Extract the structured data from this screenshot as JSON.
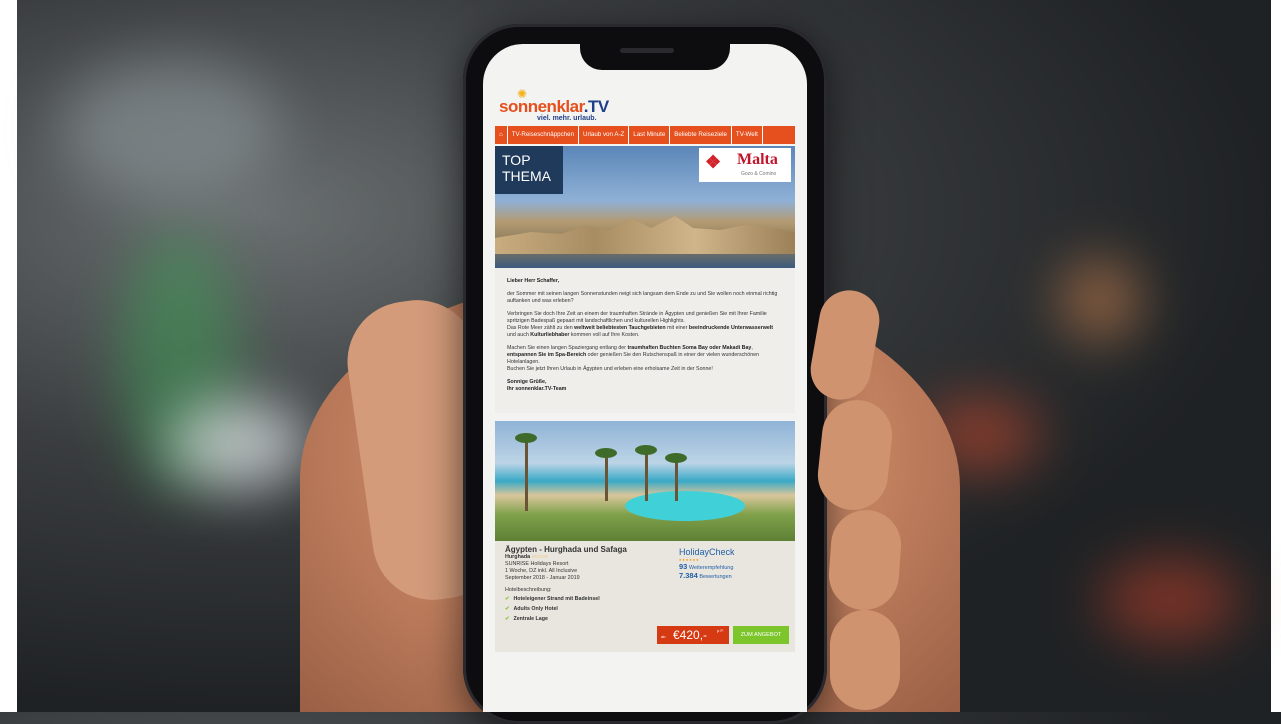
{
  "brand": {
    "name_part1": "sonnenklar",
    "name_part2": ".TV",
    "tagline": "viel. mehr. urlaub."
  },
  "nav": {
    "home_icon": "home-icon",
    "items": [
      "TV-Reiseschnäppchen",
      "Urlaub von A-Z",
      "Last Minute",
      "Beliebte Reiseziele",
      "TV-Welt"
    ]
  },
  "hero": {
    "badge_line1": "TOP",
    "badge_line2": "THEMA",
    "sponsor_name": "Malta",
    "sponsor_sub": "Gozo & Comino"
  },
  "letter": {
    "greeting": "Lieber Herr Schaffer,",
    "p1": "der Sommer mit seinen langen Sonnenstunden neigt sich langsam dem Ende zu und Sie wollen noch einmal richtig auftanken und was erleben?",
    "p2a": "Verbringen Sie doch Ihre Zeit an einem der traumhaften Strände in Ägypten und genießen Sie mit Ihrer Familie spritzigen Badespaß gepaart mit landschaftlichen und kulturellen Highlights.",
    "p2b_pre": "Das Rote Meer zählt zu den ",
    "p2b_bold1": "weltweit beliebtesten Tauchgebieten",
    "p2b_mid": " mit einer ",
    "p2b_bold2": "beeindruckende Unterwasserwelt",
    "p2b_mid2": " und auch ",
    "p2b_bold3": "Kulturliebhaber",
    "p2b_post": " kommen voll auf Ihre Kosten.",
    "p3_pre": "Machen Sie einen langen Spaziergang entlang der ",
    "p3_bold1": "traumhaften Buchten Soma Bay oder Makadi Bay",
    "p3_mid": ", ",
    "p3_bold2": "entspannen Sie im Spa-Bereich",
    "p3_post": " oder genießen Sie den Rutschenspaß in einer der vielen wunderschönen Hotelanlagen.",
    "p4": "Buchen Sie jetzt Ihren Urlaub in Ägypten und erleben eine erholsame Zeit in der Sonne!",
    "closing1": "Sonnige Grüße,",
    "closing2": "Ihr sonnenklar.TV-Team"
  },
  "offer": {
    "title": "Ägypten - Hurghada und Safaga",
    "city": "Hurghada",
    "rating_circles": "○○○○○",
    "hotel": "SUNRISE Holidays Resort",
    "duration": "1 Woche, DZ inkl. All Inclusive",
    "period": "September 2018 - Januar 2019",
    "desc_label": "Hotelbeschreibung:",
    "features": [
      "Hoteleigener Strand mit Badeinsel",
      "Adults Only Hotel",
      "Zentrale Lage"
    ],
    "hc_brand": "HolidayCheck",
    "hc_dots": "●●●●●●",
    "hc_reco_value": "93",
    "hc_reco_label": "Weiterempfehlung",
    "hc_reviews_value": "7.384",
    "hc_reviews_label": "Bewertungen",
    "price_prefix": "ab",
    "price": "€420,-",
    "price_suffix": "p.P.",
    "cta": "ZUM ANGEBOT"
  }
}
